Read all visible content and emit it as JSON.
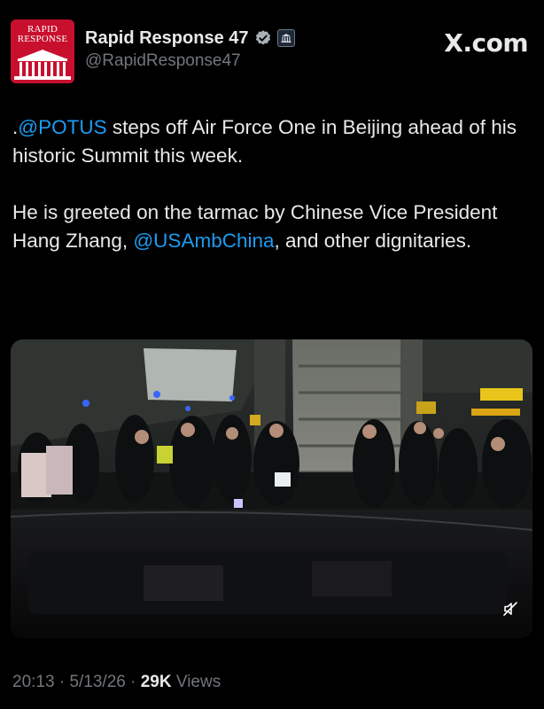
{
  "profile": {
    "avatar_line1": "RAPID",
    "avatar_line2": "RESPONSE",
    "display_name": "Rapid Response 47",
    "handle": "@RapidResponse47",
    "affiliate_badge_text": "WHITE HOUSE"
  },
  "brand": {
    "label": "X.com"
  },
  "tweet": {
    "p1_prefix": ".",
    "p1_mention": "@POTUS",
    "p1_rest": " steps off Air Force One in Beijing ahead of his historic Summit this week.",
    "p2_start": "He is greeted on the tarmac by Chinese Vice President Hang Zhang, ",
    "p2_mention": "@USAmbChina",
    "p2_end": ", and other dignitaries."
  },
  "meta": {
    "time": "20:13",
    "date": "5/13/26",
    "separator": "·",
    "views_count": "29K",
    "views_label": "Views"
  },
  "colors": {
    "accent": "#1d9bf0",
    "text_primary": "#e7e9ea",
    "text_secondary": "#71767b",
    "avatar_red": "#c8102e"
  },
  "icons": {
    "verified": "verified-badge-icon",
    "affiliate": "white-house-badge-icon",
    "mute": "muted-speaker-icon"
  }
}
